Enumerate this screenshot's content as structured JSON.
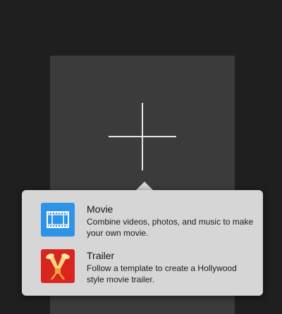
{
  "new_project": {
    "icon": "plus-icon"
  },
  "popover": {
    "options": [
      {
        "icon": "film-strip-icon",
        "icon_color": "#2d92e8",
        "title": "Movie",
        "description": "Combine videos, photos, and music to make your own movie."
      },
      {
        "icon": "spotlights-icon",
        "icon_color": "#d9251f",
        "title": "Trailer",
        "description": "Follow a template to create a Hollywood style movie trailer."
      }
    ]
  },
  "colors": {
    "background": "#1f1f1f",
    "card": "#3b3b3b",
    "popover": "#d6d6d6"
  }
}
